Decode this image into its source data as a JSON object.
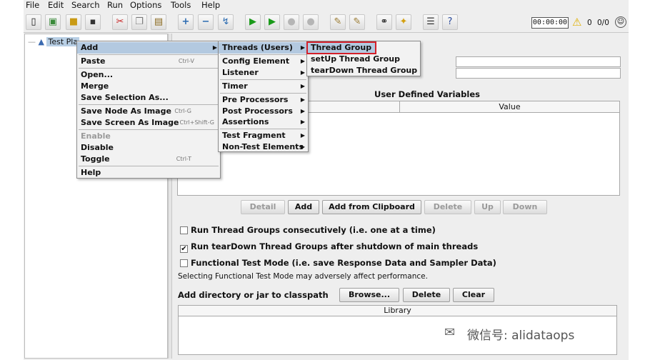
{
  "menubar": [
    "File",
    "Edit",
    "Search",
    "Run",
    "Options",
    "Tools",
    "Help"
  ],
  "toolbar": {
    "icons": [
      "new-icon",
      "templates-icon",
      "open-icon",
      "save-icon",
      "cut-icon",
      "copy-icon",
      "paste-icon",
      "expand-icon",
      "collapse-icon",
      "toggle-icon",
      "start-icon",
      "start-no-pause-icon",
      "stop-icon",
      "shutdown-icon",
      "clear-icon",
      "clear-all-icon",
      "search-icon",
      "reset-search-icon",
      "function-helper-icon",
      "help-icon"
    ],
    "timer": "00:00:00",
    "warning_count": "0",
    "threads": "0/0"
  },
  "tree": {
    "root_label": "Test Pla"
  },
  "context_menu": {
    "items": [
      {
        "label": "Add",
        "shortcut": "",
        "submenu": true
      },
      {
        "label": "Paste",
        "shortcut": "Ctrl-V"
      },
      {
        "label": "Open...",
        "shortcut": ""
      },
      {
        "label": "Merge",
        "shortcut": ""
      },
      {
        "label": "Save Selection As...",
        "shortcut": ""
      },
      {
        "label": "Save Node As Image",
        "shortcut": "Ctrl-G"
      },
      {
        "label": "Save Screen As Image",
        "shortcut": "Ctrl+Shift-G"
      },
      {
        "label": "Enable",
        "shortcut": ""
      },
      {
        "label": "Disable",
        "shortcut": ""
      },
      {
        "label": "Toggle",
        "shortcut": "Ctrl-T"
      },
      {
        "label": "Help",
        "shortcut": ""
      }
    ]
  },
  "add_submenu": [
    "Threads (Users)",
    "Config Element",
    "Listener",
    "Timer",
    "Pre Processors",
    "Post Processors",
    "Assertions",
    "Test Fragment",
    "Non-Test Elements"
  ],
  "threads_submenu": [
    "Thread Group",
    "setUp Thread Group",
    "tearDown Thread Group"
  ],
  "panel": {
    "udv_title": "User Defined Variables",
    "value_header": "Value",
    "buttons": {
      "detail": "Detail",
      "add": "Add",
      "add_clipboard": "Add from Clipboard",
      "delete": "Delete",
      "up": "Up",
      "down": "Down"
    },
    "checks": [
      {
        "label": "Run Thread Groups consecutively (i.e. one at a time)",
        "checked": false
      },
      {
        "label": "Run tearDown Thread Groups after shutdown of main threads",
        "checked": true
      },
      {
        "label": "Functional Test Mode (i.e. save Response Data and Sampler Data)",
        "checked": false
      }
    ],
    "functional_note": "Selecting Functional Test Mode may adversely affect performance.",
    "classpath_label": "Add directory or jar to classpath",
    "browse": "Browse...",
    "delete": "Delete",
    "clear": "Clear",
    "library_header": "Library"
  },
  "watermark": "微信号: alidataops",
  "highlight_color": "#d4202a"
}
